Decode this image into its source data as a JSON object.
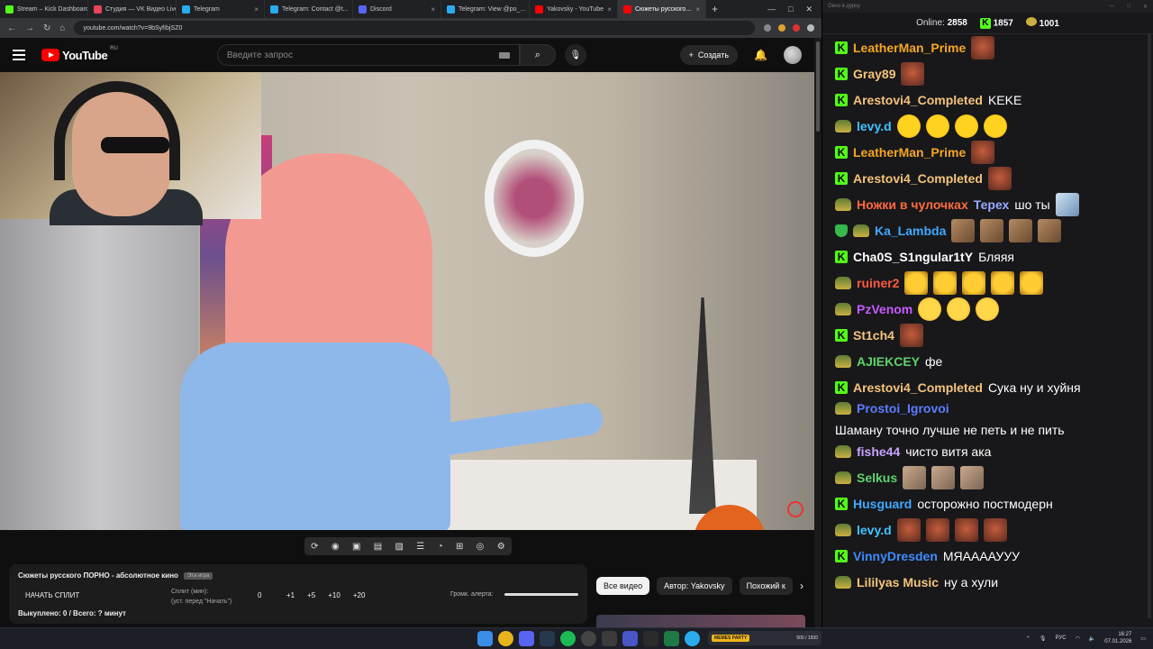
{
  "browser": {
    "tabs": [
      {
        "label": "Stream – Kick Dashboard",
        "color": "#53fc18",
        "active": false
      },
      {
        "label": "Студия — VK Видео Live",
        "color": "#e7445a",
        "active": false
      },
      {
        "label": "Telegram",
        "color": "#2aabee",
        "active": false
      },
      {
        "label": "Telegram: Contact @t...",
        "color": "#2aabee",
        "active": false
      },
      {
        "label": "Discord",
        "color": "#5865f2",
        "active": false
      },
      {
        "label": "Telegram: View @po_...",
        "color": "#2aabee",
        "active": false
      },
      {
        "label": "Yakovsky - YouTube",
        "color": "#ff0000",
        "active": false
      },
      {
        "label": "Сюжеты русского...",
        "color": "#ff0000",
        "active": true
      }
    ],
    "url": "youtube.com/watch?v=9bSyfIbjSZ0"
  },
  "youtube": {
    "logo_text": "YouTube",
    "region": "RU",
    "search_placeholder": "Введите запрос",
    "create_label": "Создать"
  },
  "split": {
    "title": "Сюжеты русского ПОРНО - абсолютное кино",
    "tag": "Эта игра",
    "start_label": "НАЧАТЬ СПЛИТ",
    "mins_label": "Сплит (мин):",
    "mins_hint": "(уст. перед \"Начать\")",
    "value": "0",
    "increments": [
      "+1",
      "+5",
      "+10",
      "+20"
    ],
    "alert_label": "Громк. алерта:",
    "bought": "Выкуплено: 0 / Всего: ? минут"
  },
  "chips": [
    "Все видео",
    "Автор: Yakovsky",
    "Похожий к"
  ],
  "chat": {
    "title_text": "Окно в дурку",
    "online_label": "Online:",
    "online_count": "2858",
    "kick_count": "1857",
    "coin_count": "1001",
    "messages": [
      {
        "badge": "kick",
        "user": "LeatherMan_Prime",
        "color": "#f5a623",
        "text": "",
        "emotes": [
          "face"
        ]
      },
      {
        "badge": "kick",
        "user": "Gray89",
        "color": "#f4c37a",
        "text": "",
        "emotes": [
          "face"
        ]
      },
      {
        "badge": "kick",
        "user": "Arestovi4_Completed",
        "color": "#f4c37a",
        "text": "KEKE",
        "emotes": []
      },
      {
        "badge": "pepe",
        "user": "levy.d",
        "color": "#3fc4ff",
        "text": "",
        "emotes": [
          "lol",
          "lol",
          "lol",
          "lol"
        ]
      },
      {
        "badge": "kick",
        "user": "LeatherMan_Prime",
        "color": "#f5a623",
        "text": "",
        "emotes": [
          "face"
        ]
      },
      {
        "badge": "kick",
        "user": "Arestovi4_Completed",
        "color": "#f4c37a",
        "text": "",
        "emotes": [
          "face"
        ]
      },
      {
        "badge": "pepe",
        "user": "Ножки в чулочках",
        "color": "#ff6a3d",
        "mention": "Терех",
        "text": "шо ты",
        "emotes": [
          "anime"
        ]
      },
      {
        "badge": "shield",
        "user": "Ka_Lambda",
        "color": "#3fa9ff",
        "text": "",
        "emotes": [
          "brown",
          "brown",
          "brown",
          "brown"
        ]
      },
      {
        "badge": "kick",
        "user": "Cha0S_S1ngular1tY",
        "color": "#ffffff",
        "text": "Бляяя",
        "emotes": []
      },
      {
        "badge": "pepe",
        "user": "ruiner2",
        "color": "#ff5a3d",
        "text": "",
        "emotes": [
          "goose",
          "goose",
          "goose",
          "goose",
          "goose"
        ]
      },
      {
        "badge": "pepe",
        "user": "PzVenom",
        "color": "#c65cff",
        "text": "",
        "emotes": [
          "laugh",
          "laugh",
          "laugh"
        ]
      },
      {
        "badge": "kick",
        "user": "St1ch4",
        "color": "#f4c37a",
        "text": "",
        "emotes": [
          "face"
        ]
      },
      {
        "badge": "pepe",
        "user": "AJIEKCEY",
        "color": "#5fd36a",
        "text": "фе",
        "emotes": []
      },
      {
        "badge": "kick",
        "user": "Arestovi4_Completed",
        "color": "#f4c37a",
        "text": "Сука ну и хуйня",
        "emotes": []
      },
      {
        "badge": "pepe",
        "user": "Prostoi_Igrovoi",
        "color": "#5c7cff",
        "text": "Шаману точно лучше не петь и не пить",
        "emotes": []
      },
      {
        "badge": "pepe",
        "user": "fishe44",
        "color": "#c5a4ff",
        "text": "чисто витя ака",
        "emotes": []
      },
      {
        "badge": "pepe",
        "user": "Selkus",
        "color": "#5fd36a",
        "text": "",
        "emotes": [
          "cat",
          "cat",
          "cat"
        ]
      },
      {
        "badge": "kick",
        "user": "Husguard",
        "color": "#3fa9ff",
        "text": "осторожно постмодерн",
        "emotes": []
      },
      {
        "badge": "pepe",
        "user": "levy.d",
        "color": "#3fc4ff",
        "text": "",
        "emotes": [
          "face",
          "face",
          "face",
          "face"
        ]
      },
      {
        "badge": "kick",
        "user": "VinnyDresden",
        "color": "#3f8cff",
        "text": "МЯААААУУУ",
        "emotes": []
      },
      {
        "badge": "pepe",
        "user": "Lililyas Music",
        "color": "#f4c37a",
        "text": "ну а хули",
        "emotes": []
      }
    ]
  },
  "taskbar": {
    "memes_label": "MEMES PARTY",
    "memes_count": "500 / 1500",
    "lang": "РУС",
    "time": "16:27",
    "date": "07.01.2026"
  }
}
